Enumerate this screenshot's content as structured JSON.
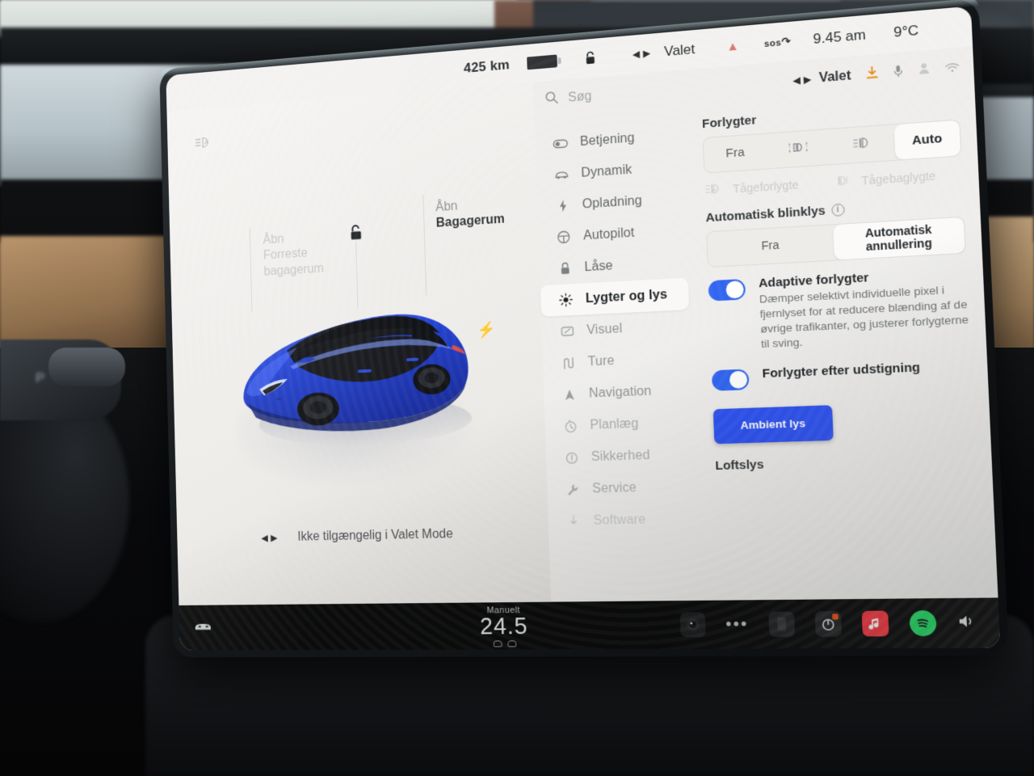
{
  "statusbar": {
    "range": "425 km",
    "battery_icon": "battery-icon",
    "lock_icon": "unlocked-padlock-icon",
    "valet_icon": "valet-bowtie-icon",
    "valet_label": "Valet",
    "pin_icon": "red-pin-icon",
    "sos_label": "sos",
    "time": "9.45 am",
    "temperature": "9°C"
  },
  "car_panel": {
    "auto_headlight_icon": "auto-headlight-beam-icon",
    "front_trunk": {
      "line1": "Åbn",
      "line2": "Forreste",
      "line3": "bagagerum"
    },
    "rear_trunk": {
      "line1": "Åbn",
      "line2": "Bagagerum"
    },
    "lock_icon": "unlocked-padlock-icon",
    "charge_port_icon": "charge-bolt-icon",
    "valet_note": "Ikke tilgængelig i Valet Mode",
    "valet_note_icon": "valet-bowtie-icon",
    "car_color": "#2242d8",
    "car_roof_color": "#121318"
  },
  "settings": {
    "search": {
      "icon": "search-icon",
      "placeholder": "Søg",
      "value": ""
    },
    "topbar": {
      "valet_icon": "valet-bowtie-icon",
      "valet_label": "Valet",
      "download_icon": "download-icon",
      "download_color": "#e8890c",
      "mute_icon": "microphone-mute-icon",
      "user_icon": "user-profile-icon",
      "wifi_icon": "wifi-icon"
    },
    "nav": [
      {
        "label": "Betjening",
        "icon": "toggle-switch-icon",
        "state": "normal"
      },
      {
        "label": "Dynamik",
        "icon": "car-side-icon",
        "state": "normal"
      },
      {
        "label": "Opladning",
        "icon": "bolt-icon",
        "state": "normal"
      },
      {
        "label": "Autopilot",
        "icon": "steering-wheel-icon",
        "state": "normal"
      },
      {
        "label": "Låse",
        "icon": "padlock-icon",
        "state": "normal"
      },
      {
        "label": "Lygter og lys",
        "icon": "sun-light-icon",
        "state": "active"
      },
      {
        "label": "Visuel",
        "icon": "display-icon",
        "state": "faded"
      },
      {
        "label": "Ture",
        "icon": "road-icon",
        "state": "faded"
      },
      {
        "label": "Navigation",
        "icon": "navigation-arrow-icon",
        "state": "faded"
      },
      {
        "label": "Planlæg",
        "icon": "clock-icon",
        "state": "faded2"
      },
      {
        "label": "Sikkerhed",
        "icon": "exclamation-circle-icon",
        "state": "faded2"
      },
      {
        "label": "Service",
        "icon": "wrench-icon",
        "state": "faded2"
      },
      {
        "label": "Software",
        "icon": "download-arrow-icon",
        "state": "faded2"
      }
    ],
    "headlights": {
      "title": "Forlygter",
      "options": [
        {
          "label": "Fra",
          "icon": "",
          "selected": false
        },
        {
          "label": "",
          "icon": "parking-lights-icon",
          "selected": false
        },
        {
          "label": "",
          "icon": "low-beam-icon",
          "selected": false
        },
        {
          "label": "Auto",
          "icon": "",
          "selected": true
        }
      ]
    },
    "fog": {
      "front": {
        "label": "Tågeforlygte",
        "icon": "front-fog-lamp-icon",
        "enabled": false
      },
      "rear": {
        "label": "Tågebaglygte",
        "icon": "rear-fog-lamp-icon",
        "enabled": false
      }
    },
    "turn_signal": {
      "title": "Automatisk blinklys",
      "info_icon": "info-icon",
      "options": [
        {
          "label": "Fra",
          "selected": false
        },
        {
          "label": "Automatisk annullering",
          "selected": true
        }
      ]
    },
    "toggles": [
      {
        "title": "Adaptive forlygter",
        "description": "Dæmper selektivt individuelle pixel i fjernlyset for at reducere blænding af de øvrige trafikanter, og justerer forlygterne til sving.",
        "on": true
      },
      {
        "title": "Forlygter efter udstigning",
        "description": "",
        "on": true
      }
    ],
    "ambient_button": {
      "label": "Ambient lys",
      "color": "#2a4ff0"
    },
    "ceiling_label": "Loftslys"
  },
  "bottombar": {
    "car_icon": "car-front-icon",
    "climate": {
      "mode": "Manuelt",
      "temp": "24.5",
      "seat_left_icon": "seat-heater-icon",
      "seat_right_icon": "seat-heater-icon"
    },
    "apps": [
      {
        "name": "camera-app-icon",
        "glyph": "◉"
      },
      {
        "name": "more-apps-icon",
        "glyph": "•••"
      },
      {
        "name": "phone-app-icon",
        "glyph": "▯"
      },
      {
        "name": "toybox-app-icon",
        "glyph": "◐"
      },
      {
        "name": "music-app-icon",
        "glyph": "♫"
      },
      {
        "name": "spotify-app-icon",
        "glyph": "≋"
      }
    ],
    "volume_icon": "volume-icon"
  },
  "environment": {
    "gear_indicator": "P"
  }
}
